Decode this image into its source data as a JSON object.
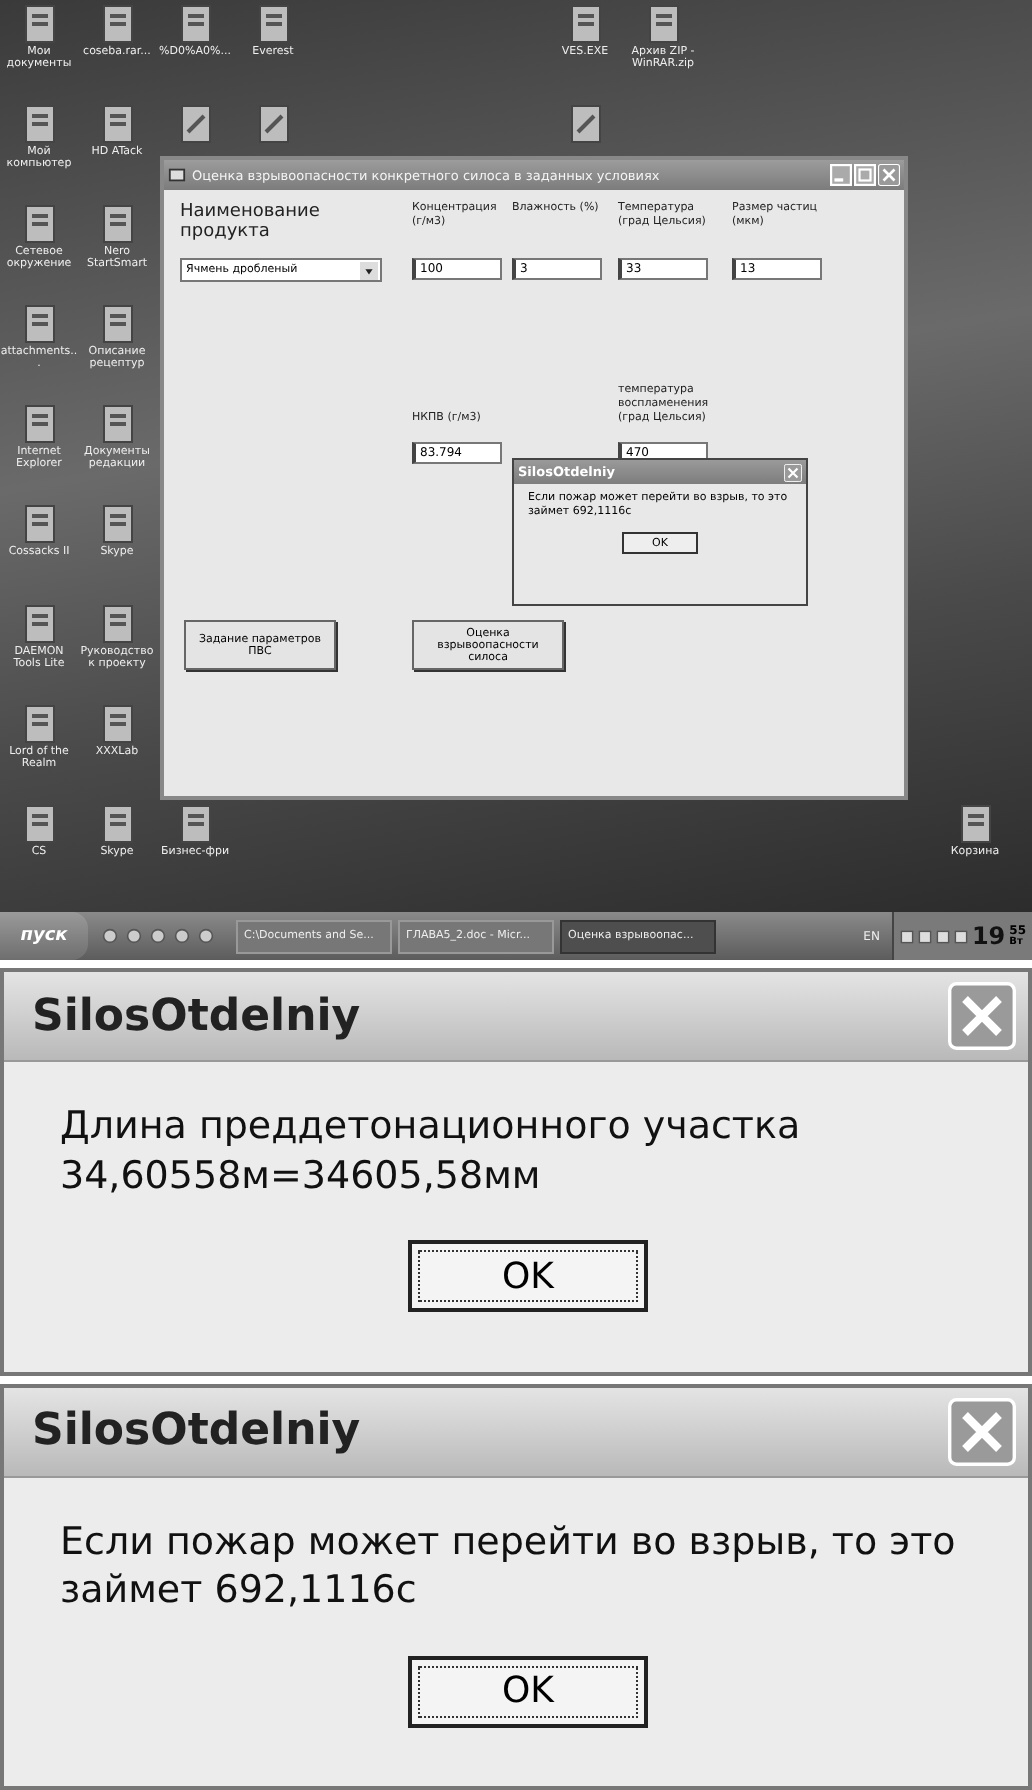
{
  "desktop": {
    "icons": [
      {
        "label": "Мои документы"
      },
      {
        "label": "coseba.rar..."
      },
      {
        "label": "%D0%A0%..."
      },
      {
        "label": "Everest"
      },
      {
        "label": "VES.EXE"
      },
      {
        "label": "Архив ZIP - WinRAR.zip"
      },
      {
        "label": "Мой компьютер"
      },
      {
        "label": "HD ATack"
      },
      {
        "label": "Сетевое окружение"
      },
      {
        "label": "Nero StartSmart"
      },
      {
        "label": "attachments..."
      },
      {
        "label": "Описание рецептур"
      },
      {
        "label": "Internet Explorer"
      },
      {
        "label": "Документы редакции"
      },
      {
        "label": "Cossacks II"
      },
      {
        "label": "Skype"
      },
      {
        "label": "DAEMON Tools Lite"
      },
      {
        "label": "Руководство к проекту"
      },
      {
        "label": "Lord of the Realm"
      },
      {
        "label": "XXXLab"
      },
      {
        "label": "CS"
      },
      {
        "label": "Skype"
      },
      {
        "label": "Бизнес-фри"
      },
      {
        "label": "Корзина"
      }
    ]
  },
  "window": {
    "title": "Оценка взрывоопасности конкретного силоса в заданных условиях",
    "product_label": "Наименование продукта",
    "product_value": "Ячмень дробленый",
    "fields": [
      {
        "label": "Концентрация (г/м3)",
        "value": "100"
      },
      {
        "label": "Влажность (%)",
        "value": "3"
      },
      {
        "label": "Температура (град Цельсия)",
        "value": "33"
      },
      {
        "label": "Размер частиц (мкм)",
        "value": "13"
      }
    ],
    "result_fields": [
      {
        "label": "НКПВ (г/м3)",
        "value": "83.794"
      },
      {
        "label": "температура воспламенения (град Цельсия)",
        "value": "470"
      }
    ],
    "buttons": [
      "Задание параметров ПВС",
      "Оценка взрывоопасности силоса"
    ],
    "message_box": {
      "title": "SilosOtdelniy",
      "text": "Если пожар может перейти во взрыв, то это займет 692,1116с",
      "button": "OK"
    }
  },
  "taskbar": {
    "start": "пуск",
    "tasks": [
      {
        "label": "C:\\Documents and Se...",
        "selected": false
      },
      {
        "label": "ГЛАВА5_2.doc - Micr...",
        "selected": false
      },
      {
        "label": "Оценка взрывоопас...",
        "selected": true
      }
    ],
    "language": "EN",
    "clock_hours": "19",
    "clock_minutes": "55",
    "clock_day": "Вт"
  },
  "enlarged_dialogs": [
    {
      "title": "SilosOtdelniy",
      "text": "Длина преддетонационного участка 34,60558м=34605,58мм",
      "button": "OK"
    },
    {
      "title": "SilosOtdelniy",
      "text": "Если пожар может перейти во взрыв, то это займет 692,1116с",
      "button": "OK"
    }
  ]
}
